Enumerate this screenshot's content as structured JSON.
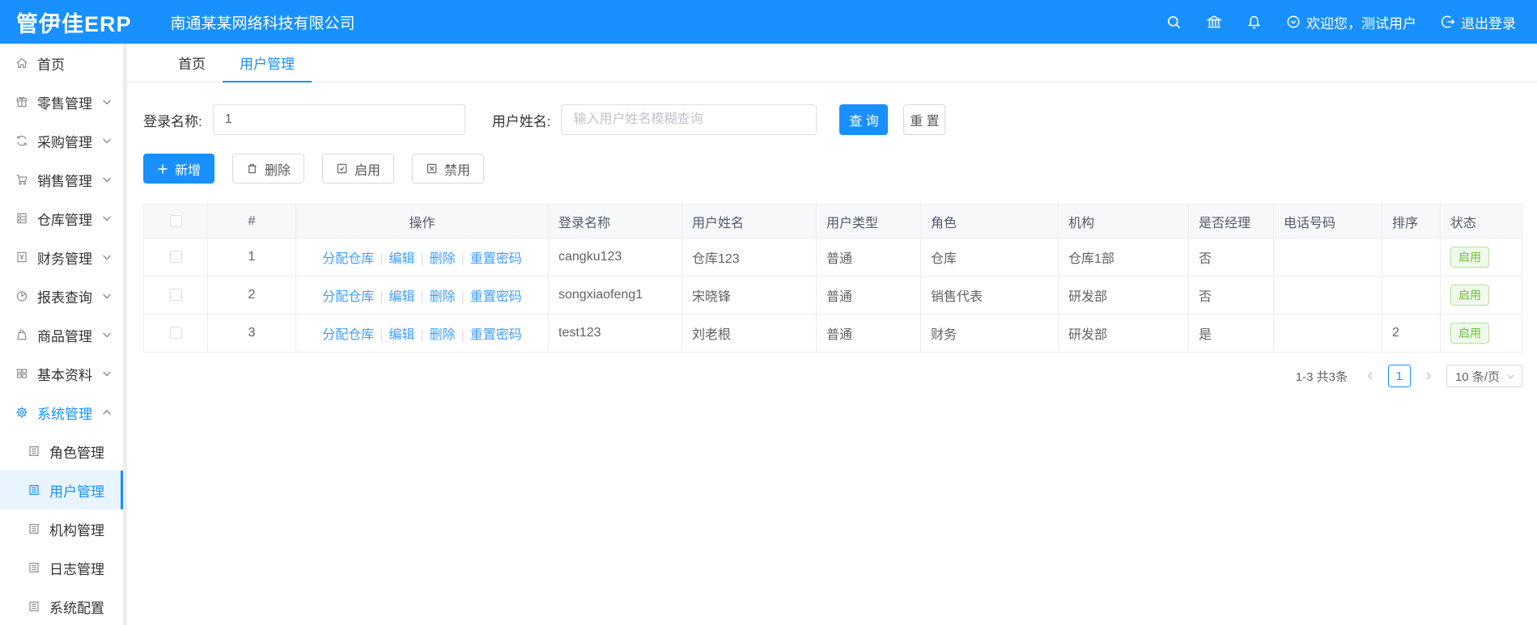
{
  "header": {
    "logo": "管伊佳ERP",
    "company": "南通某某网络科技有限公司",
    "welcome_text": "欢迎您，测试用户",
    "logout_text": "退出登录"
  },
  "tabs": [
    {
      "label": "首页",
      "active": false
    },
    {
      "label": "用户管理",
      "active": true
    }
  ],
  "search_form": {
    "login_label": "登录名称:",
    "login_value": "1",
    "name_label": "用户姓名:",
    "name_placeholder": "输入用户姓名模糊查询",
    "query_button": "查 询",
    "reset_button": "重 置"
  },
  "toolbar": {
    "add_label": "新增",
    "delete_label": "删除",
    "enable_label": "启用",
    "disable_label": "禁用"
  },
  "table": {
    "columns": [
      "#",
      "操作",
      "登录名称",
      "用户姓名",
      "用户类型",
      "角色",
      "机构",
      "是否经理",
      "电话号码",
      "排序",
      "状态"
    ],
    "action_links": [
      "分配仓库",
      "编辑",
      "删除",
      "重置密码"
    ],
    "rows": [
      {
        "index": "1",
        "login": "cangku123",
        "name": "仓库123",
        "type": "普通",
        "role": "仓库",
        "org": "仓库1部",
        "manager": "否",
        "phone": "",
        "sort": "",
        "status": "启用"
      },
      {
        "index": "2",
        "login": "songxiaofeng1",
        "name": "宋晓锋",
        "type": "普通",
        "role": "销售代表",
        "org": "研发部",
        "manager": "否",
        "phone": "",
        "sort": "",
        "status": "启用"
      },
      {
        "index": "3",
        "login": "test123",
        "name": "刘老根",
        "type": "普通",
        "role": "财务",
        "org": "研发部",
        "manager": "是",
        "phone": "",
        "sort": "2",
        "status": "启用"
      }
    ]
  },
  "pagination": {
    "total_text": "1-3 共3条",
    "current_page": "1",
    "page_size": "10 条/页"
  },
  "sidebar": {
    "items": [
      {
        "key": "home",
        "label": "首页",
        "icon": "home-icon",
        "expandable": false
      },
      {
        "key": "retail",
        "label": "零售管理",
        "icon": "gift-icon",
        "expandable": true
      },
      {
        "key": "purchase",
        "label": "采购管理",
        "icon": "sync-icon",
        "expandable": true
      },
      {
        "key": "sales",
        "label": "销售管理",
        "icon": "cart-icon",
        "expandable": true
      },
      {
        "key": "warehouse",
        "label": "仓库管理",
        "icon": "warehouse-icon",
        "expandable": true
      },
      {
        "key": "finance",
        "label": "财务管理",
        "icon": "finance-icon",
        "expandable": true
      },
      {
        "key": "report",
        "label": "报表查询",
        "icon": "report-icon",
        "expandable": true
      },
      {
        "key": "goods",
        "label": "商品管理",
        "icon": "goods-icon",
        "expandable": true
      },
      {
        "key": "basic",
        "label": "基本资料",
        "icon": "grid-icon",
        "expandable": true
      },
      {
        "key": "system",
        "label": "系统管理",
        "icon": "gear-icon",
        "expandable": true,
        "expanded": true,
        "active": true
      }
    ],
    "sub_items": [
      {
        "key": "role",
        "label": "角色管理",
        "active": false
      },
      {
        "key": "user",
        "label": "用户管理",
        "active": true
      },
      {
        "key": "org",
        "label": "机构管理",
        "active": false
      },
      {
        "key": "log",
        "label": "日志管理",
        "active": false
      },
      {
        "key": "config",
        "label": "系统配置",
        "active": false
      }
    ]
  },
  "colors": {
    "primary": "#1890ff",
    "link": "#409eff",
    "status_green": "#67c23a",
    "header_bg": "#1890ff"
  }
}
